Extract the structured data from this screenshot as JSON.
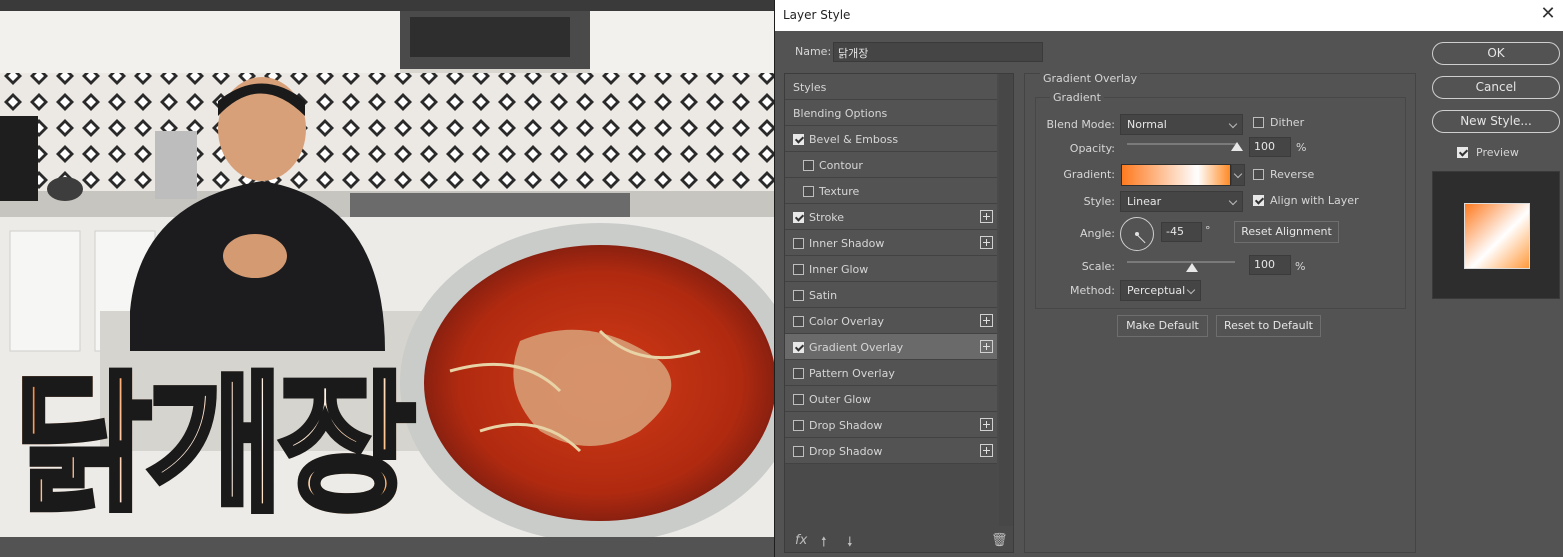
{
  "canvas": {
    "title_text": "닭개장"
  },
  "dialog": {
    "title": "Layer Style",
    "close_icon": "close-icon",
    "name_label": "Name:",
    "name_value": "닭개장",
    "styles": [
      {
        "label": "Styles",
        "kind": "head"
      },
      {
        "label": "Blending Options",
        "kind": "head"
      },
      {
        "label": "Bevel & Emboss",
        "kind": "lvl0",
        "checked": true,
        "plus": false
      },
      {
        "label": "Contour",
        "kind": "lvl1",
        "checked": false,
        "plus": false
      },
      {
        "label": "Texture",
        "kind": "lvl1",
        "checked": false,
        "plus": false
      },
      {
        "label": "Stroke",
        "kind": "lvl0",
        "checked": true,
        "plus": true
      },
      {
        "label": "Inner Shadow",
        "kind": "lvl0",
        "checked": false,
        "plus": true
      },
      {
        "label": "Inner Glow",
        "kind": "lvl0",
        "checked": false,
        "plus": false
      },
      {
        "label": "Satin",
        "kind": "lvl0",
        "checked": false,
        "plus": false
      },
      {
        "label": "Color Overlay",
        "kind": "lvl0",
        "checked": false,
        "plus": true
      },
      {
        "label": "Gradient Overlay",
        "kind": "lvl0",
        "checked": true,
        "plus": true,
        "active": true
      },
      {
        "label": "Pattern Overlay",
        "kind": "lvl0",
        "checked": false,
        "plus": false
      },
      {
        "label": "Outer Glow",
        "kind": "lvl0",
        "checked": false,
        "plus": false
      },
      {
        "label": "Drop Shadow",
        "kind": "lvl0",
        "checked": false,
        "plus": true
      },
      {
        "label": "Drop Shadow",
        "kind": "lvl0",
        "checked": false,
        "plus": true
      }
    ],
    "footer": {
      "fx": "fx",
      "up_arrow": "🠕",
      "down_arrow": "🠗",
      "trash": "🗑"
    },
    "section": {
      "title": "Gradient Overlay",
      "group": "Gradient",
      "blend_mode_label": "Blend Mode:",
      "blend_mode_value": "Normal",
      "dither_label": "Dither",
      "dither_checked": false,
      "opacity_label": "Opacity:",
      "opacity_value": "100",
      "opacity_fraction": 1.0,
      "percent": "%",
      "gradient_label": "Gradient:",
      "reverse_label": "Reverse",
      "reverse_checked": false,
      "style_label": "Style:",
      "style_value": "Linear",
      "align_label": "Align with Layer",
      "align_checked": true,
      "angle_label": "Angle:",
      "angle_value": "-45",
      "degree": "°",
      "reset_alignment": "Reset Alignment",
      "scale_label": "Scale:",
      "scale_value": "100",
      "scale_fraction": 0.6,
      "method_label": "Method:",
      "method_value": "Perceptual",
      "make_default": "Make Default",
      "reset_default": "Reset to Default"
    },
    "buttons": {
      "ok": "OK",
      "cancel": "Cancel",
      "new_style": "New Style...",
      "preview_label": "Preview",
      "preview_checked": true
    },
    "colors": {
      "gradient_start": "#ff7a1f",
      "gradient_mid": "#ffffff",
      "gradient_end": "#ff8a25"
    }
  }
}
